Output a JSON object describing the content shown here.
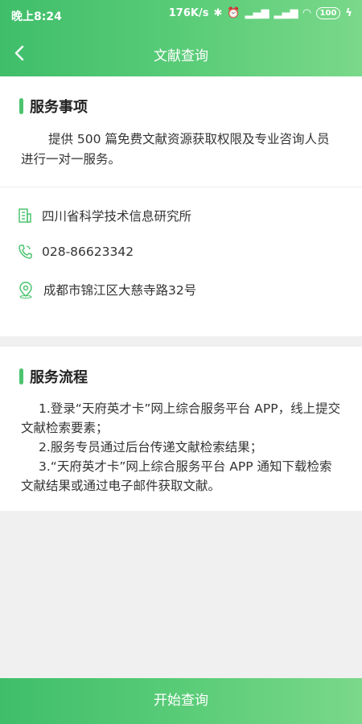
{
  "status_bar": {
    "time": "晚上8:24",
    "speed": "176K/s",
    "battery": "100"
  },
  "nav": {
    "title": "文献查询"
  },
  "service_items": {
    "title": "服务事项",
    "description_line1": "提供 500 篇免费文献资源获取权限及专业咨询人员",
    "description_line2": "进行一对一服务。"
  },
  "contact": {
    "institution": "四川省科学技术信息研究所",
    "phone": "028-86623342",
    "address": "成都市锦江区大慈寺路32号"
  },
  "process": {
    "title": "服务流程",
    "step1_line1": "1.登录“天府英才卡”网上综合服务平台 APP，线上提交",
    "step1_line2": "文献检索要素；",
    "step2": "2.服务专员通过后台传递文献检索结果；",
    "step3_line1": "3.“天府英才卡”网上综合服务平台 APP 通知下载检索",
    "step3_line2": "文献结果或通过电子邮件获取文献。"
  },
  "bottom": {
    "button_label": "开始查询"
  },
  "colors": {
    "accent": "#4cc46f",
    "header_start": "#3fbe6a",
    "header_end": "#7ad88a"
  }
}
